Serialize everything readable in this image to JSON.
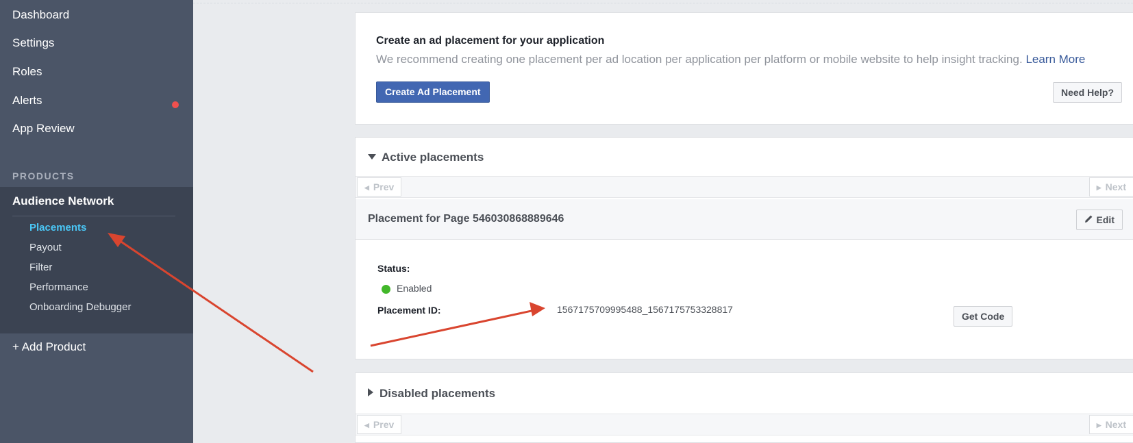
{
  "sidebar": {
    "items": [
      {
        "label": "Dashboard"
      },
      {
        "label": "Settings"
      },
      {
        "label": "Roles"
      },
      {
        "label": "Alerts"
      },
      {
        "label": "App Review"
      }
    ],
    "products_header": "PRODUCTS",
    "product": {
      "title": "Audience Network",
      "sub_items": [
        {
          "label": "Placements",
          "active": true
        },
        {
          "label": "Payout"
        },
        {
          "label": "Filter"
        },
        {
          "label": "Performance"
        },
        {
          "label": "Onboarding Debugger"
        }
      ]
    },
    "add_product": "+ Add Product"
  },
  "create_card": {
    "title": "Create an ad placement for your application",
    "description": "We recommend creating one placement per ad location per application per platform or mobile website to help insight tracking.",
    "learn_more": "Learn More",
    "create_button": "Create Ad Placement",
    "help_button": "Need Help?"
  },
  "active_section": {
    "title": "Active placements",
    "prev": "Prev",
    "next": "Next",
    "placement": {
      "title": "Placement for Page 546030868889646",
      "edit": "Edit",
      "status_label": "Status:",
      "status_value": "Enabled",
      "id_label": "Placement ID:",
      "id_value": "1567175709995488_1567175753328817",
      "get_code": "Get Code"
    }
  },
  "disabled_section": {
    "title": "Disabled placements",
    "prev": "Prev",
    "next": "Next"
  },
  "colors": {
    "sidebar_bg": "#4b5567",
    "active_link": "#4ac7f6",
    "primary_button": "#4267b2",
    "status_enabled": "#42b72a",
    "alert_dot": "#f0504e",
    "annotation_arrow": "#d9452f"
  }
}
